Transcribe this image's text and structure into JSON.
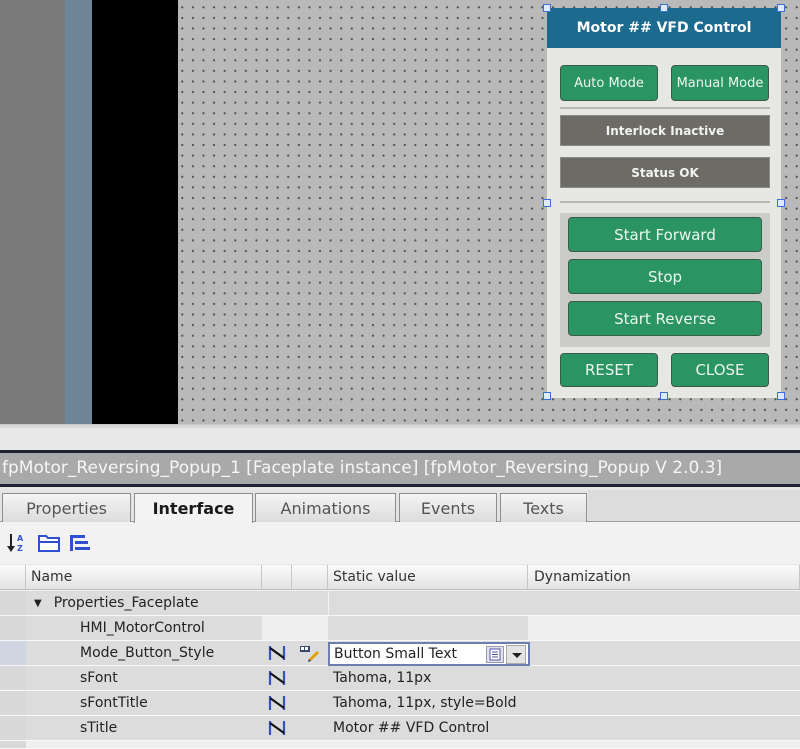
{
  "faceplate": {
    "title": "Motor ## VFD Control",
    "mode_buttons": [
      "Auto Mode",
      "Manual Mode"
    ],
    "status": [
      "Interlock Inactive",
      "Status OK"
    ],
    "command_buttons": [
      "Start Forward",
      "Stop",
      "Start Reverse"
    ],
    "bottom_buttons": [
      "RESET",
      "CLOSE"
    ],
    "colors": {
      "title_bar": "#1c6a8e",
      "button_green": "#2a9563",
      "status_gray": "#6d6b66"
    }
  },
  "inspector": {
    "title": "fpMotor_Reversing_Popup_1 [Faceplate instance] [fpMotor_Reversing_Popup V 2.0.3]",
    "tabs": [
      "Properties",
      "Interface",
      "Animations",
      "Events",
      "Texts"
    ],
    "active_tab": "Interface",
    "toolbar_icons": [
      "sort-az-icon",
      "folder-icon",
      "list-indent-icon"
    ],
    "columns": [
      "Name",
      "",
      "",
      "Static value",
      "Dynamization"
    ],
    "group": "Properties_Faceplate",
    "rows": [
      {
        "name": "HMI_MotorControl",
        "value": "",
        "has_dyn_icon": false
      },
      {
        "name": "Mode_Button_Style",
        "value": "Button Small Text",
        "has_dyn_icon": true,
        "editing": true
      },
      {
        "name": "sFont",
        "value": "Tahoma, 11px",
        "has_dyn_icon": true
      },
      {
        "name": "sFontTitle",
        "value": "Tahoma, 11px, style=Bold",
        "has_dyn_icon": true
      },
      {
        "name": "sTitle",
        "value": "Motor ## VFD Control",
        "has_dyn_icon": true
      }
    ]
  }
}
